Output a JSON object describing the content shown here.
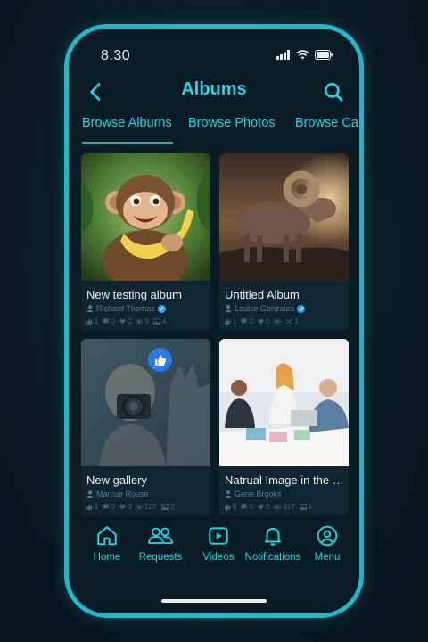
{
  "status": {
    "time": "8:30"
  },
  "header": {
    "title": "Albums"
  },
  "tabs": [
    {
      "label": "Browse Alburns"
    },
    {
      "label": "Browse Photos"
    },
    {
      "label": "Browse Ca"
    }
  ],
  "albums": [
    {
      "title": "New testing album",
      "author": "Richard Thomas",
      "verified": true,
      "stats": [
        "1",
        "0",
        "0",
        "9",
        "4"
      ]
    },
    {
      "title": "Untitled Album",
      "author": "Louise Gonzales",
      "verified": true,
      "stats": [
        "1",
        "0",
        "0",
        "1"
      ]
    },
    {
      "title": "New gallery",
      "author": "Marcue Rouse",
      "verified": false,
      "stats": [
        "1",
        "0",
        "0",
        "127",
        "2"
      ]
    },
    {
      "title": "Natrual Image in the w..",
      "author": "Gene Brooks",
      "verified": false,
      "stats": [
        "0",
        "0",
        "0",
        "917",
        "4"
      ]
    }
  ],
  "nav": [
    {
      "label": "Home"
    },
    {
      "label": "Requests"
    },
    {
      "label": "Videos"
    },
    {
      "label": "Notifications"
    },
    {
      "label": "Menu"
    }
  ],
  "colors": {
    "accent": "#2ad3e6",
    "frame": "#1fb8cc",
    "background": "#071c25",
    "card": "#0d2632"
  }
}
